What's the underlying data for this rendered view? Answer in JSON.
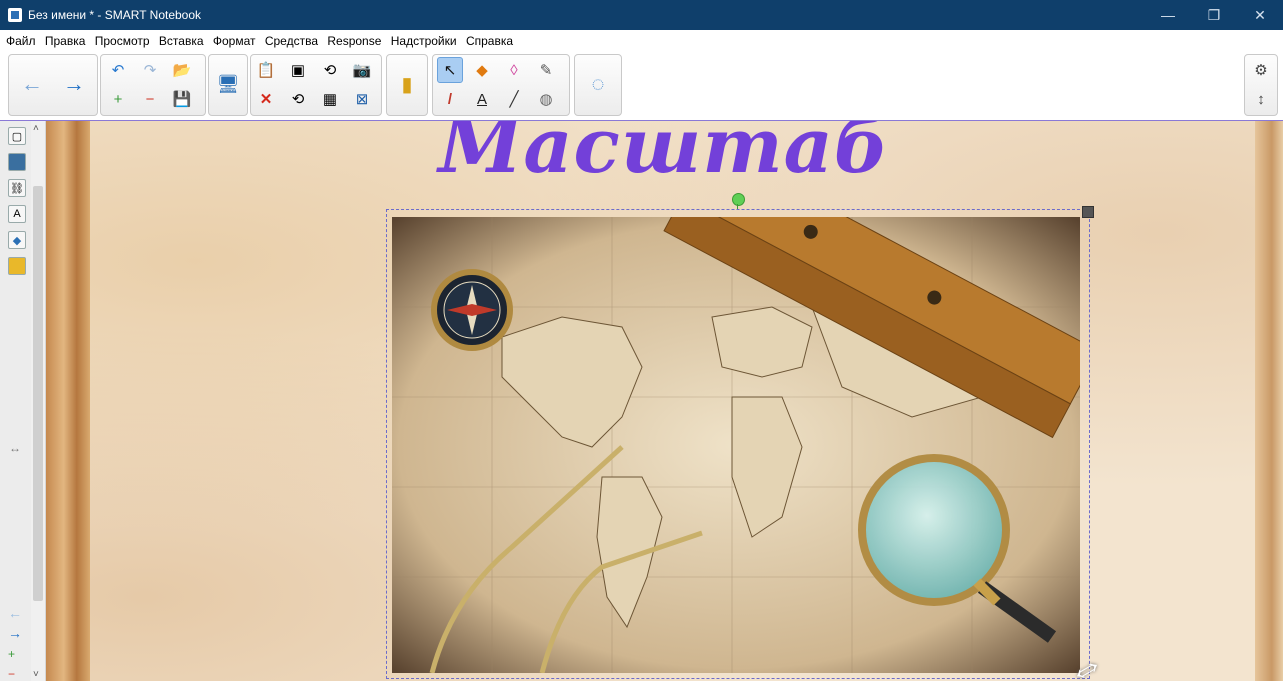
{
  "window": {
    "title": "Без имени * - SMART Notebook",
    "controls": {
      "minimize": "—",
      "maximize": "❐",
      "close": "✕"
    }
  },
  "menu": [
    "Файл",
    "Правка",
    "Просмотр",
    "Вставка",
    "Формат",
    "Средства",
    "Response",
    "Надстройки",
    "Справка"
  ],
  "toolbar_icons": {
    "back": "←",
    "forward": "→",
    "undo": "↶",
    "redo": "↷",
    "open": "📂",
    "add_page": "+",
    "delete_page": "−",
    "save": "💾",
    "display": "🖥",
    "paste": "📋",
    "screen_shade": "▣",
    "delete": "✕",
    "clear_page": "⟲",
    "capture": "📷",
    "table": "▦",
    "fullscreen": "⊠",
    "gallery": "▮",
    "select": "↖",
    "pens": "/",
    "shapes": "◆",
    "text": "A",
    "eraser": "◊",
    "lines": "╱",
    "fill": "◍",
    "magic_pen": "✎",
    "more": "◌",
    "settings": "⚙",
    "move_toolbar": "↕"
  },
  "side_tabs": [
    "page-sorter",
    "gallery",
    "attachments",
    "properties",
    "add-ons",
    "lesson-activity"
  ],
  "side_arrow": "↔",
  "canvas": {
    "heading": "Масштаб",
    "image_description_colors": {
      "heading": "#7340d9",
      "selection": "#6b6bcb",
      "rotate_handle": "#5fcf55"
    }
  }
}
